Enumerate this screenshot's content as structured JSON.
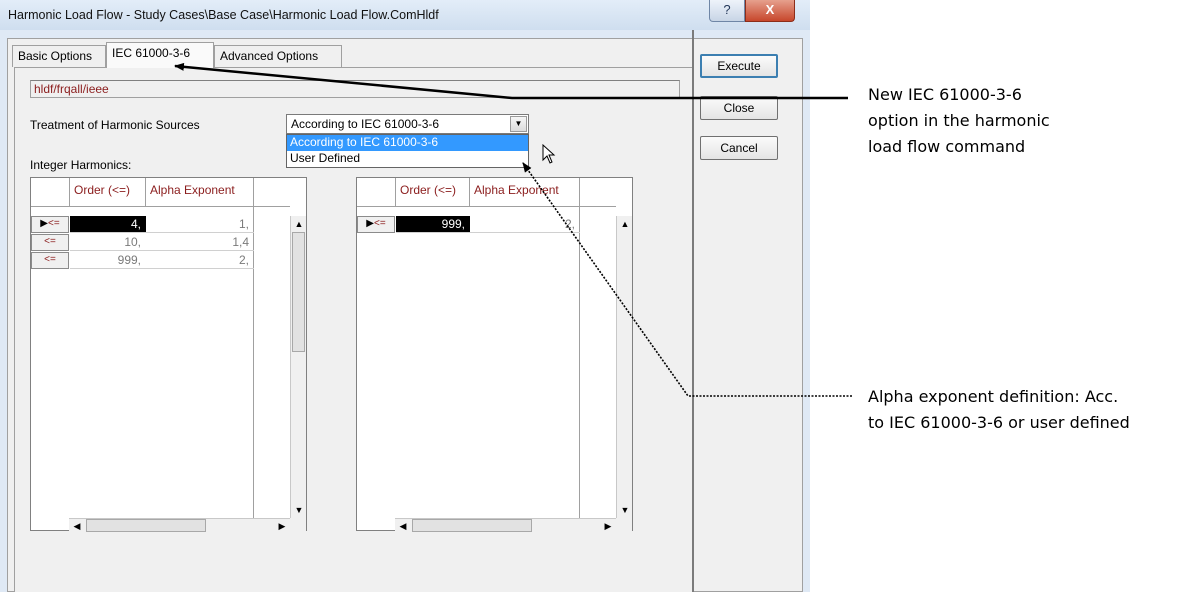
{
  "window": {
    "title": "Harmonic Load Flow - Study Cases\\Base Case\\Harmonic Load Flow.ComHldf",
    "help_glyph": "?",
    "close_glyph": "X"
  },
  "tabs": [
    {
      "label": "Basic Options"
    },
    {
      "label": "IEC 61000-3-6"
    },
    {
      "label": "Advanced Options"
    }
  ],
  "command_path": "hldf/frqall/ieee",
  "treatment": {
    "label": "Treatment of Harmonic Sources",
    "selected": "According to IEC 61000-3-6",
    "options": [
      "According to IEC 61000-3-6",
      "User Defined"
    ]
  },
  "integer_harmonics_label": "Integer Harmonics:",
  "left_table": {
    "columns": [
      "Order (<=)",
      "Alpha Exponent"
    ],
    "rows": [
      {
        "marker": "<=",
        "order": "4,",
        "alpha": "1,"
      },
      {
        "marker": "<=",
        "order": "10,",
        "alpha": "1,4"
      },
      {
        "marker": "<=",
        "order": "999,",
        "alpha": "2,"
      }
    ]
  },
  "right_table": {
    "columns": [
      "Order (<=)",
      "Alpha Exponent"
    ],
    "rows": [
      {
        "marker": "<=",
        "order": "999,",
        "alpha": "2,"
      }
    ]
  },
  "buttons": {
    "execute": "Execute",
    "close": "Close",
    "cancel": "Cancel"
  },
  "annotations": {
    "tab_note": [
      "New IEC 61000-3-6",
      "option in the harmonic",
      "load flow command"
    ],
    "alpha_note": [
      "Alpha exponent definition: Acc.",
      "to IEC 61000-3-6 or user defined"
    ]
  },
  "icons": {
    "row_pointer": "right-triangle-icon",
    "up": "up-arrow-icon",
    "down": "down-arrow-icon",
    "left": "left-arrow-icon",
    "right": "right-arrow-icon",
    "cursor": "mouse-pointer-icon"
  },
  "colors": {
    "header_text": "#8b1d1d",
    "selection": "#3399ff"
  }
}
